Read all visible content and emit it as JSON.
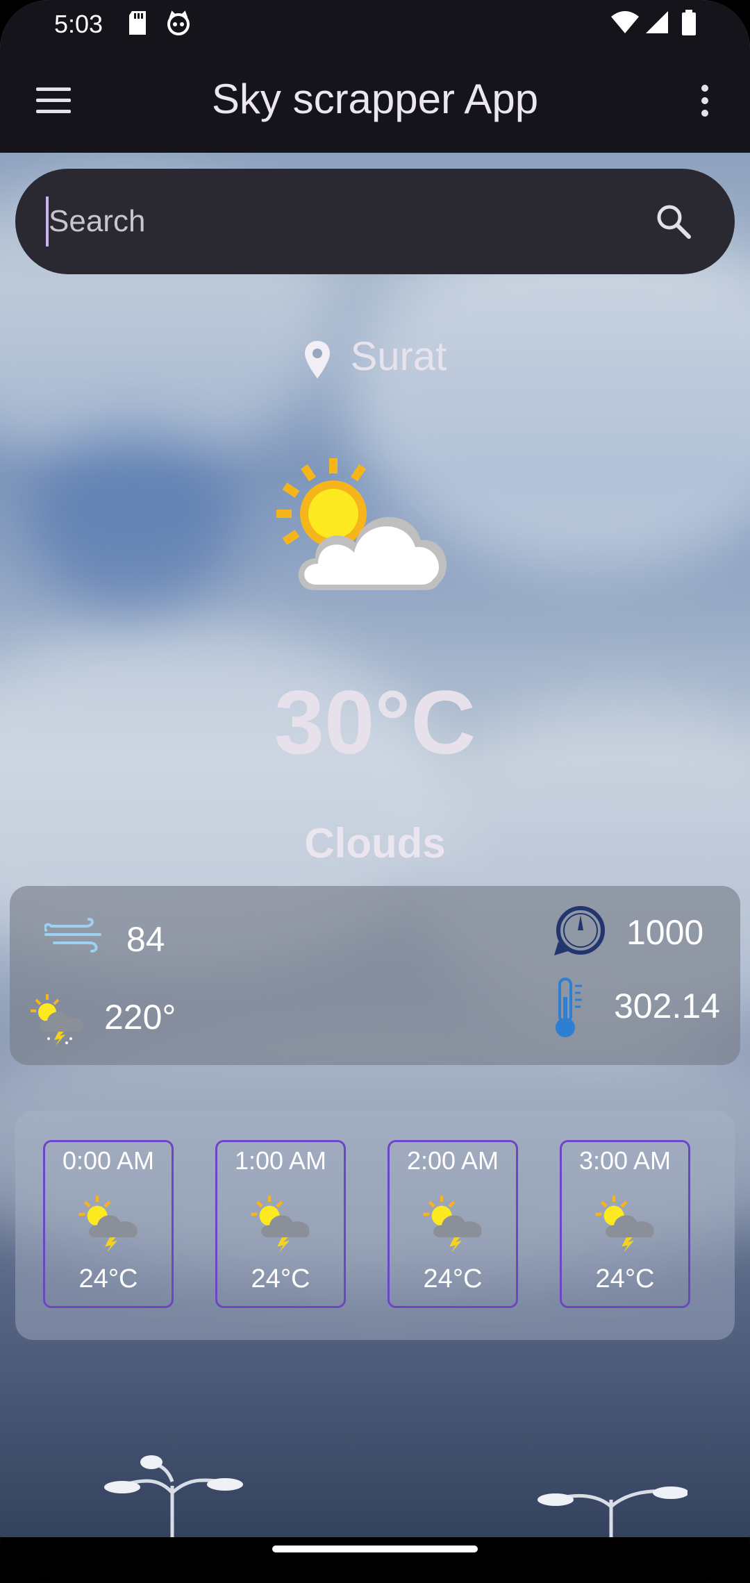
{
  "status_bar": {
    "time": "5:03"
  },
  "app_bar": {
    "title": "Sky scrapper App"
  },
  "search": {
    "placeholder": "Search",
    "value": ""
  },
  "location": {
    "city": "Surat"
  },
  "current": {
    "temperature": "30°C",
    "condition": "Clouds"
  },
  "details": {
    "wind_speed": "84",
    "wind_degree": "220°",
    "pressure": "1000",
    "temperature_k": "302.14"
  },
  "hourly": [
    {
      "time": "0:00 AM",
      "temp": "24°C"
    },
    {
      "time": "1:00 AM",
      "temp": "24°C"
    },
    {
      "time": "2:00 AM",
      "temp": "24°C"
    },
    {
      "time": "3:00 AM",
      "temp": "24°C"
    }
  ],
  "icons": {
    "menu": "menu-icon",
    "more": "more-vert-icon",
    "search": "search-icon",
    "location": "location-pin-icon",
    "weather": "partly-cloudy-icon",
    "wind": "wind-icon",
    "storm": "thunderstorm-icon",
    "pressure": "gauge-icon",
    "thermometer": "thermometer-icon"
  },
  "colors": {
    "app_bar": "#16141b",
    "accent": "#6b46c5",
    "cursor": "#c8b5ef"
  }
}
